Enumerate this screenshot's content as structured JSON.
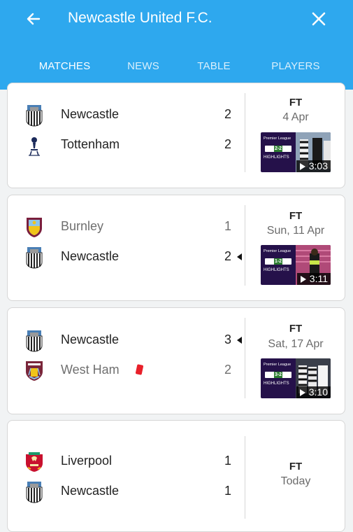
{
  "header": {
    "title": "Newcastle United F.C.",
    "back_icon": "arrow-left-icon",
    "close_icon": "close-icon",
    "background": "#2ea8ee"
  },
  "tabs": [
    {
      "label": "MATCHES",
      "active": true
    },
    {
      "label": "NEWS",
      "active": false
    },
    {
      "label": "TABLE",
      "active": false
    },
    {
      "label": "PLAYERS",
      "active": false
    }
  ],
  "matches": [
    {
      "home": {
        "name": "Newcastle",
        "score": "2",
        "crest": "newcastle-crest-icon"
      },
      "away": {
        "name": "Tottenham",
        "score": "2",
        "crest": "tottenham-crest-icon"
      },
      "status": "FT",
      "date": "4 Apr",
      "video": {
        "duration": "3:03",
        "league": "Premier League",
        "label": "HIGHLIGHTS",
        "score": "2-2"
      }
    },
    {
      "home": {
        "name": "Burnley",
        "score": "1",
        "crest": "burnley-crest-icon"
      },
      "away": {
        "name": "Newcastle",
        "score": "2",
        "crest": "newcastle-crest-icon"
      },
      "status": "FT",
      "date": "Sun, 11 Apr",
      "video": {
        "duration": "3:11",
        "league": "Premier League",
        "label": "HIGHLIGHTS",
        "score": "1-2"
      }
    },
    {
      "home": {
        "name": "Newcastle",
        "score": "3",
        "crest": "newcastle-crest-icon"
      },
      "away": {
        "name": "West Ham",
        "score": "2",
        "crest": "west-ham-crest-icon",
        "red_card": true
      },
      "status": "FT",
      "date": "Sat, 17 Apr",
      "video": {
        "duration": "3:10",
        "league": "Premier League",
        "label": "HIGHLIGHTS",
        "score": "3-2"
      }
    },
    {
      "home": {
        "name": "Liverpool",
        "score": "1",
        "crest": "liverpool-crest-icon"
      },
      "away": {
        "name": "Newcastle",
        "score": "1",
        "crest": "newcastle-crest-icon"
      },
      "status": "FT",
      "date": "Today"
    }
  ],
  "colors": {
    "red_card": "#e8202a",
    "text": "#222222",
    "muted": "#6f6f6f"
  }
}
